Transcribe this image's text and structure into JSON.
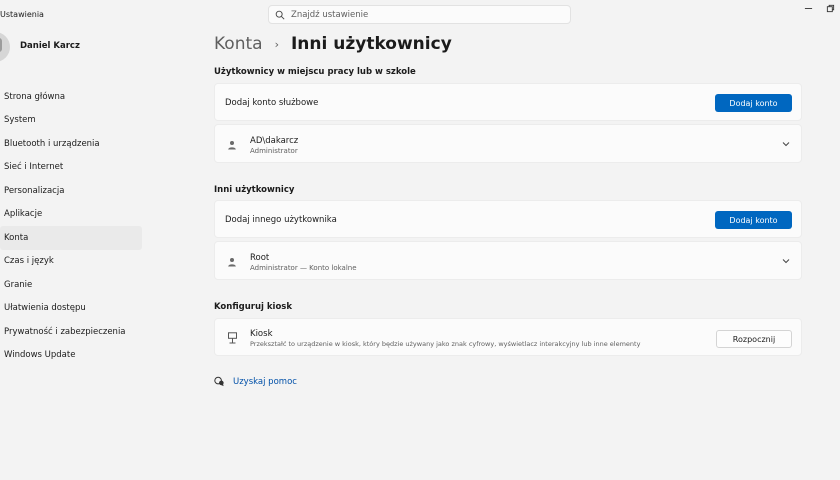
{
  "app": {
    "title": "Ustawienia"
  },
  "search": {
    "placeholder": "Znajdź ustawienie"
  },
  "user": {
    "name": "Daniel Karcz"
  },
  "sidebar": {
    "items": [
      {
        "label": "Strona główna"
      },
      {
        "label": "System"
      },
      {
        "label": "Bluetooth i urządzenia"
      },
      {
        "label": "Sieć i Internet"
      },
      {
        "label": "Personalizacja"
      },
      {
        "label": "Aplikacje"
      },
      {
        "label": "Konta"
      },
      {
        "label": "Czas i język"
      },
      {
        "label": "Granie"
      },
      {
        "label": "Ułatwienia dostępu"
      },
      {
        "label": "Prywatność i zabezpieczenia"
      },
      {
        "label": "Windows Update"
      }
    ],
    "active": "Konta"
  },
  "breadcrumb": {
    "parent": "Konta",
    "separator": "›",
    "current": "Inni użytkownicy"
  },
  "work_section": {
    "title": "Użytkownicy w miejscu pracy lub w szkole",
    "add_label": "Dodaj konto służbowe",
    "add_button": "Dodaj konto",
    "account": {
      "name": "AD\\dakarcz",
      "role": "Administrator"
    }
  },
  "other_section": {
    "title": "Inni użytkownicy",
    "add_label": "Dodaj innego użytkownika",
    "add_button": "Dodaj konto",
    "account": {
      "name": "Root",
      "role": "Administrator — Konto lokalne"
    }
  },
  "kiosk_section": {
    "title": "Konfiguruj kiosk",
    "name": "Kiosk",
    "description": "Przekształć to urządzenie w kiosk, który będzie używany jako znak cyfrowy, wyświetlacz interakcyjny lub inne elementy",
    "button": "Rozpocznij"
  },
  "help": {
    "label": "Uzyskaj pomoc"
  },
  "colors": {
    "accent": "#0067c0",
    "link": "#0050a8",
    "background": "#f3f3f3",
    "card": "#fbfbfb"
  }
}
